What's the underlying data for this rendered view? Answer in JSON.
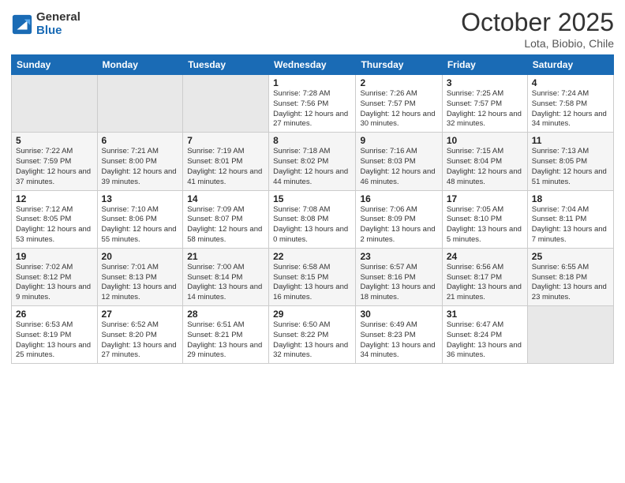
{
  "header": {
    "logo_line1": "General",
    "logo_line2": "Blue",
    "month": "October 2025",
    "location": "Lota, Biobio, Chile"
  },
  "weekdays": [
    "Sunday",
    "Monday",
    "Tuesday",
    "Wednesday",
    "Thursday",
    "Friday",
    "Saturday"
  ],
  "weeks": [
    [
      {
        "day": "",
        "info": ""
      },
      {
        "day": "",
        "info": ""
      },
      {
        "day": "",
        "info": ""
      },
      {
        "day": "1",
        "info": "Sunrise: 7:28 AM\nSunset: 7:56 PM\nDaylight: 12 hours and 27 minutes."
      },
      {
        "day": "2",
        "info": "Sunrise: 7:26 AM\nSunset: 7:57 PM\nDaylight: 12 hours and 30 minutes."
      },
      {
        "day": "3",
        "info": "Sunrise: 7:25 AM\nSunset: 7:57 PM\nDaylight: 12 hours and 32 minutes."
      },
      {
        "day": "4",
        "info": "Sunrise: 7:24 AM\nSunset: 7:58 PM\nDaylight: 12 hours and 34 minutes."
      }
    ],
    [
      {
        "day": "5",
        "info": "Sunrise: 7:22 AM\nSunset: 7:59 PM\nDaylight: 12 hours and 37 minutes."
      },
      {
        "day": "6",
        "info": "Sunrise: 7:21 AM\nSunset: 8:00 PM\nDaylight: 12 hours and 39 minutes."
      },
      {
        "day": "7",
        "info": "Sunrise: 7:19 AM\nSunset: 8:01 PM\nDaylight: 12 hours and 41 minutes."
      },
      {
        "day": "8",
        "info": "Sunrise: 7:18 AM\nSunset: 8:02 PM\nDaylight: 12 hours and 44 minutes."
      },
      {
        "day": "9",
        "info": "Sunrise: 7:16 AM\nSunset: 8:03 PM\nDaylight: 12 hours and 46 minutes."
      },
      {
        "day": "10",
        "info": "Sunrise: 7:15 AM\nSunset: 8:04 PM\nDaylight: 12 hours and 48 minutes."
      },
      {
        "day": "11",
        "info": "Sunrise: 7:13 AM\nSunset: 8:05 PM\nDaylight: 12 hours and 51 minutes."
      }
    ],
    [
      {
        "day": "12",
        "info": "Sunrise: 7:12 AM\nSunset: 8:05 PM\nDaylight: 12 hours and 53 minutes."
      },
      {
        "day": "13",
        "info": "Sunrise: 7:10 AM\nSunset: 8:06 PM\nDaylight: 12 hours and 55 minutes."
      },
      {
        "day": "14",
        "info": "Sunrise: 7:09 AM\nSunset: 8:07 PM\nDaylight: 12 hours and 58 minutes."
      },
      {
        "day": "15",
        "info": "Sunrise: 7:08 AM\nSunset: 8:08 PM\nDaylight: 13 hours and 0 minutes."
      },
      {
        "day": "16",
        "info": "Sunrise: 7:06 AM\nSunset: 8:09 PM\nDaylight: 13 hours and 2 minutes."
      },
      {
        "day": "17",
        "info": "Sunrise: 7:05 AM\nSunset: 8:10 PM\nDaylight: 13 hours and 5 minutes."
      },
      {
        "day": "18",
        "info": "Sunrise: 7:04 AM\nSunset: 8:11 PM\nDaylight: 13 hours and 7 minutes."
      }
    ],
    [
      {
        "day": "19",
        "info": "Sunrise: 7:02 AM\nSunset: 8:12 PM\nDaylight: 13 hours and 9 minutes."
      },
      {
        "day": "20",
        "info": "Sunrise: 7:01 AM\nSunset: 8:13 PM\nDaylight: 13 hours and 12 minutes."
      },
      {
        "day": "21",
        "info": "Sunrise: 7:00 AM\nSunset: 8:14 PM\nDaylight: 13 hours and 14 minutes."
      },
      {
        "day": "22",
        "info": "Sunrise: 6:58 AM\nSunset: 8:15 PM\nDaylight: 13 hours and 16 minutes."
      },
      {
        "day": "23",
        "info": "Sunrise: 6:57 AM\nSunset: 8:16 PM\nDaylight: 13 hours and 18 minutes."
      },
      {
        "day": "24",
        "info": "Sunrise: 6:56 AM\nSunset: 8:17 PM\nDaylight: 13 hours and 21 minutes."
      },
      {
        "day": "25",
        "info": "Sunrise: 6:55 AM\nSunset: 8:18 PM\nDaylight: 13 hours and 23 minutes."
      }
    ],
    [
      {
        "day": "26",
        "info": "Sunrise: 6:53 AM\nSunset: 8:19 PM\nDaylight: 13 hours and 25 minutes."
      },
      {
        "day": "27",
        "info": "Sunrise: 6:52 AM\nSunset: 8:20 PM\nDaylight: 13 hours and 27 minutes."
      },
      {
        "day": "28",
        "info": "Sunrise: 6:51 AM\nSunset: 8:21 PM\nDaylight: 13 hours and 29 minutes."
      },
      {
        "day": "29",
        "info": "Sunrise: 6:50 AM\nSunset: 8:22 PM\nDaylight: 13 hours and 32 minutes."
      },
      {
        "day": "30",
        "info": "Sunrise: 6:49 AM\nSunset: 8:23 PM\nDaylight: 13 hours and 34 minutes."
      },
      {
        "day": "31",
        "info": "Sunrise: 6:47 AM\nSunset: 8:24 PM\nDaylight: 13 hours and 36 minutes."
      },
      {
        "day": "",
        "info": ""
      }
    ]
  ]
}
